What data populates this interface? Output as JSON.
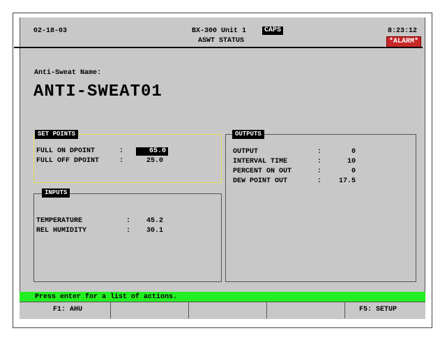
{
  "header": {
    "date": "02-18-03",
    "device": "BX-300 Unit 1",
    "caps": "CAPS",
    "screen_title": "ASWT STATUS",
    "time": "8:23:12",
    "alarm": "*ALARM*"
  },
  "name_section": {
    "label": "Anti-Sweat Name:",
    "value": "ANTI-SWEAT01"
  },
  "set_points": {
    "title": "SET POINTS",
    "rows": [
      {
        "label": "FULL ON DPOINT",
        "sep": ":",
        "value": "65.0"
      },
      {
        "label": "FULL OFF DPOINT",
        "sep": ":",
        "value": "25.0"
      }
    ]
  },
  "inputs": {
    "title": "INPUTS",
    "rows": [
      {
        "label": "TEMPERATURE",
        "sep": ":",
        "value": "45.2"
      },
      {
        "label": "REL HUMIDITY",
        "sep": ":",
        "value": "30.1"
      }
    ]
  },
  "outputs": {
    "title": "OUTPUTS",
    "rows": [
      {
        "label": "OUTPUT",
        "sep": ":",
        "value": "0"
      },
      {
        "label": "INTERVAL TIME",
        "sep": ":",
        "value": "10"
      },
      {
        "label": "PERCENT ON OUT",
        "sep": ":",
        "value": "0"
      },
      {
        "label": "DEW POINT OUT",
        "sep": ":",
        "value": "17.5"
      }
    ]
  },
  "status_bar": {
    "message": "Press enter for a list of actions."
  },
  "function_keys": [
    {
      "label": "F1: AHU"
    },
    {
      "label": ""
    },
    {
      "label": ""
    },
    {
      "label": ""
    },
    {
      "label": "F5: SETUP"
    }
  ],
  "colors": {
    "screen_background": "#c8c8c8",
    "status_bar": "#22ee22",
    "alarm_badge": "#c62828",
    "set_points_highlight": "#e8e05a"
  }
}
